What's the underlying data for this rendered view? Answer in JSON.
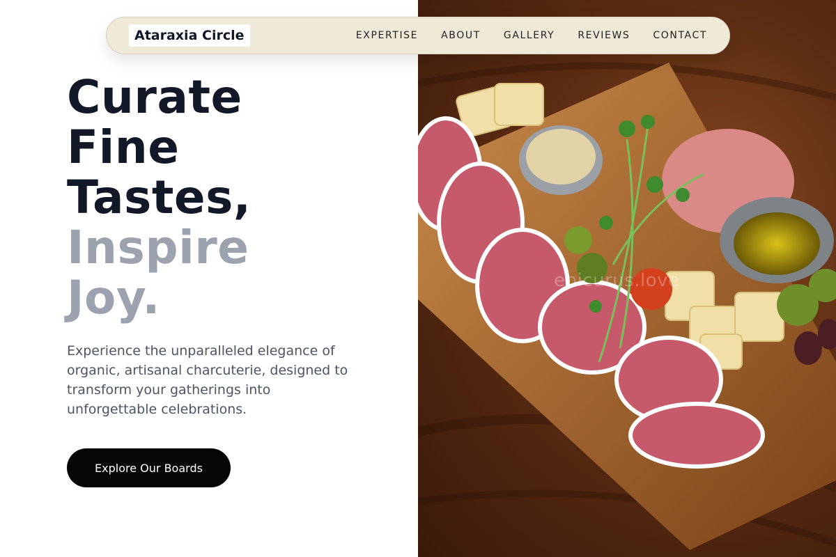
{
  "brand": {
    "name": "Ataraxia Circle"
  },
  "nav": {
    "links": [
      "EXPERTISE",
      "ABOUT",
      "GALLERY",
      "REVIEWS",
      "CONTACT"
    ]
  },
  "hero": {
    "headline_dark": [
      "Curate",
      "Fine",
      "Tastes,"
    ],
    "headline_muted": [
      "Inspire",
      "Joy."
    ],
    "description": "Experience the unparalleled elegance of organic, artisanal charcuterie, designed to transform your gatherings into unforgettable celebrations.",
    "cta_label": "Explore Our Boards"
  },
  "image": {
    "watermark": "epicurus.love"
  },
  "colors": {
    "navbar_bg": "#efe9d7",
    "headline_dark": "#111827",
    "headline_muted": "#9ca3af",
    "body_text": "#4b5563",
    "cta_bg": "#050505"
  }
}
